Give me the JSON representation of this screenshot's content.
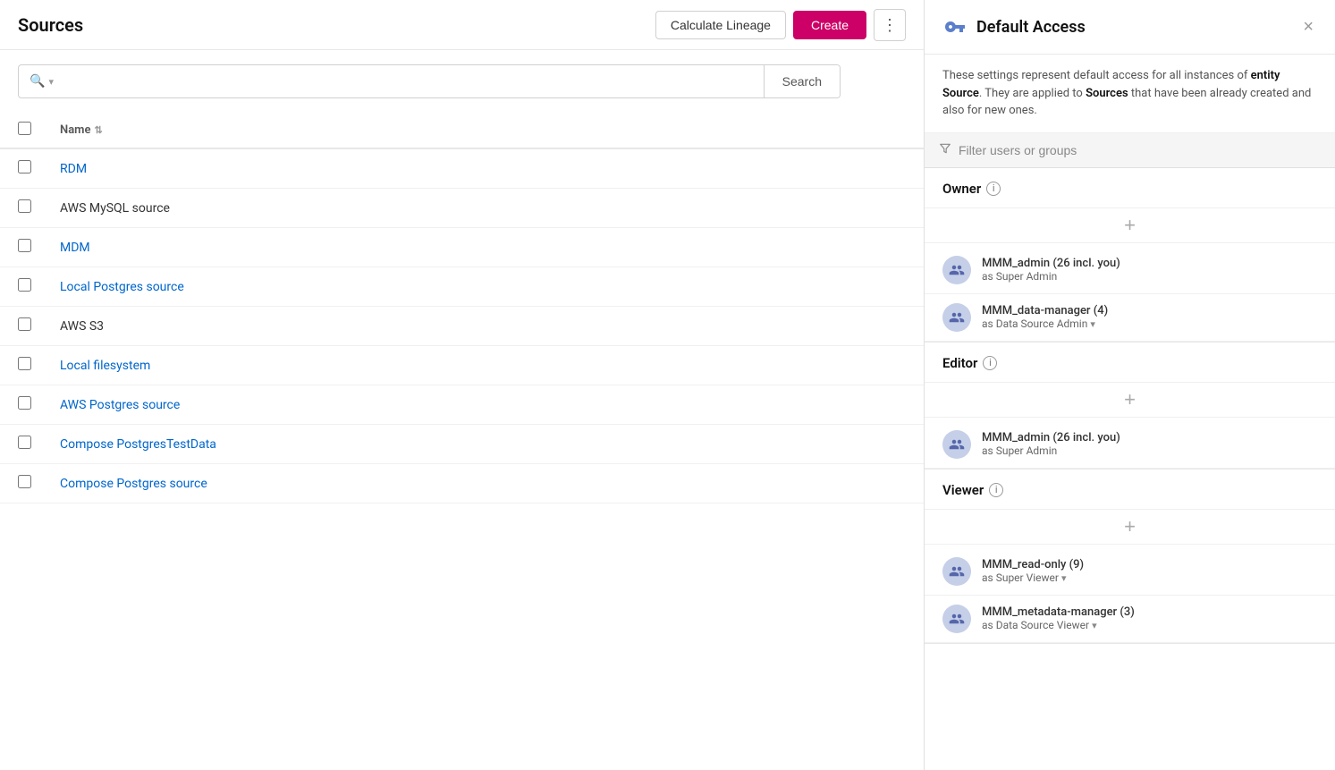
{
  "page": {
    "title": "Sources"
  },
  "header": {
    "calculate_lineage_label": "Calculate Lineage",
    "create_label": "Create",
    "more_icon": "⋮"
  },
  "search": {
    "placeholder": "",
    "button_label": "Search",
    "filter_icon": "🔍",
    "dropdown_icon": "▾"
  },
  "table": {
    "columns": [
      {
        "id": "name",
        "label": "Name",
        "sortable": true
      }
    ],
    "rows": [
      {
        "id": 1,
        "name": "RDM",
        "link": true
      },
      {
        "id": 2,
        "name": "AWS MySQL source",
        "link": false
      },
      {
        "id": 3,
        "name": "MDM",
        "link": true
      },
      {
        "id": 4,
        "name": "Local Postgres source",
        "link": true
      },
      {
        "id": 5,
        "name": "AWS S3",
        "link": false
      },
      {
        "id": 6,
        "name": "Local filesystem",
        "link": true
      },
      {
        "id": 7,
        "name": "AWS Postgres source",
        "link": true
      },
      {
        "id": 8,
        "name": "Compose PostgresTestData",
        "link": true
      },
      {
        "id": 9,
        "name": "Compose Postgres source",
        "link": true
      }
    ]
  },
  "panel": {
    "title": "Default Access",
    "icon_label": "key-icon",
    "close_label": "×",
    "description_part1": "These settings represent default access for all instances of ",
    "description_entity": "entity Source",
    "description_part2": ". They are applied to ",
    "description_sources": "Sources",
    "description_part3": " that have been already created and also for new ones.",
    "filter_placeholder": "Filter users or groups",
    "sections": [
      {
        "id": "owner",
        "title": "Owner",
        "members": [
          {
            "name": "MMM_admin (26 incl. you)",
            "role": "as Super Admin",
            "has_dropdown": false
          },
          {
            "name": "MMM_data-manager (4)",
            "role": "as Data Source Admin",
            "has_dropdown": true
          }
        ]
      },
      {
        "id": "editor",
        "title": "Editor",
        "members": [
          {
            "name": "MMM_admin (26 incl. you)",
            "role": "as Super Admin",
            "has_dropdown": false
          }
        ]
      },
      {
        "id": "viewer",
        "title": "Viewer",
        "members": [
          {
            "name": "MMM_read-only (9)",
            "role": "as Super Viewer",
            "has_dropdown": true
          },
          {
            "name": "MMM_metadata-manager (3)",
            "role": "as Data Source Viewer",
            "has_dropdown": true
          }
        ]
      }
    ]
  }
}
